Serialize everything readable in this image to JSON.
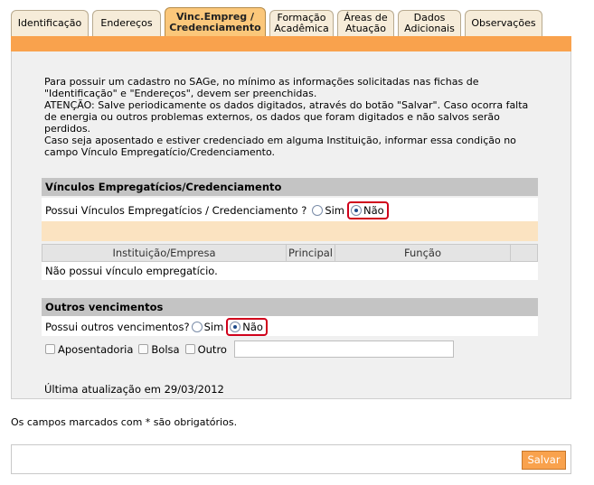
{
  "tabs": [
    {
      "label_line1": "Identificação",
      "label_line2": ""
    },
    {
      "label_line1": "Endereços",
      "label_line2": ""
    },
    {
      "label_line1": "Vinc.Empreg /",
      "label_line2": "Credenciamento"
    },
    {
      "label_line1": "Formação",
      "label_line2": "Acadêmica"
    },
    {
      "label_line1": "Áreas de",
      "label_line2": "Atuação"
    },
    {
      "label_line1": "Dados",
      "label_line2": "Adicionais"
    },
    {
      "label_line1": "Observações",
      "label_line2": ""
    }
  ],
  "active_tab_index": 2,
  "intro": {
    "lines": [
      "Para possuir um cadastro no SAGe, no mínimo as informações solicitadas nas fichas de",
      "\"Identificação\" e \"Endereços\", devem ser preenchidas.",
      "ATENÇÃO: Salve periodicamente os dados digitados, através do botão \"Salvar\". Caso ocorra falta",
      "de energia ou outros problemas externos, os dados que foram digitados e não salvos serão",
      "perdidos.",
      "Caso seja aposentado e estiver credenciado em alguma Instituição, informar essa condição no",
      "campo Vínculo Empregatício/Credenciamento."
    ]
  },
  "vinculos": {
    "header": "Vínculos Empregatícios/Credenciamento",
    "question": "Possui Vínculos Empregatícios / Credenciamento ?",
    "option_yes": "Sim",
    "option_no": "Não",
    "selected": "Não",
    "table": {
      "columns": [
        "Instituição/Empresa",
        "Principal",
        "Função"
      ],
      "empty_message": "Não possui vínculo empregatício."
    }
  },
  "outros": {
    "header": "Outros vencimentos",
    "question": "Possui outros vencimentos?",
    "option_yes": "Sim",
    "option_no": "Não",
    "selected": "Não",
    "checkboxes": [
      "Aposentadoria",
      "Bolsa",
      "Outro"
    ],
    "outro_value": ""
  },
  "last_update": "Última atualização em 29/03/2012",
  "required_note": "Os campos marcados com * são obrigatórios.",
  "save_label": "Salvar",
  "colors": {
    "accent": "#f9a24d",
    "active_tab": "#fbc77a",
    "highlight": "#d0021b"
  }
}
